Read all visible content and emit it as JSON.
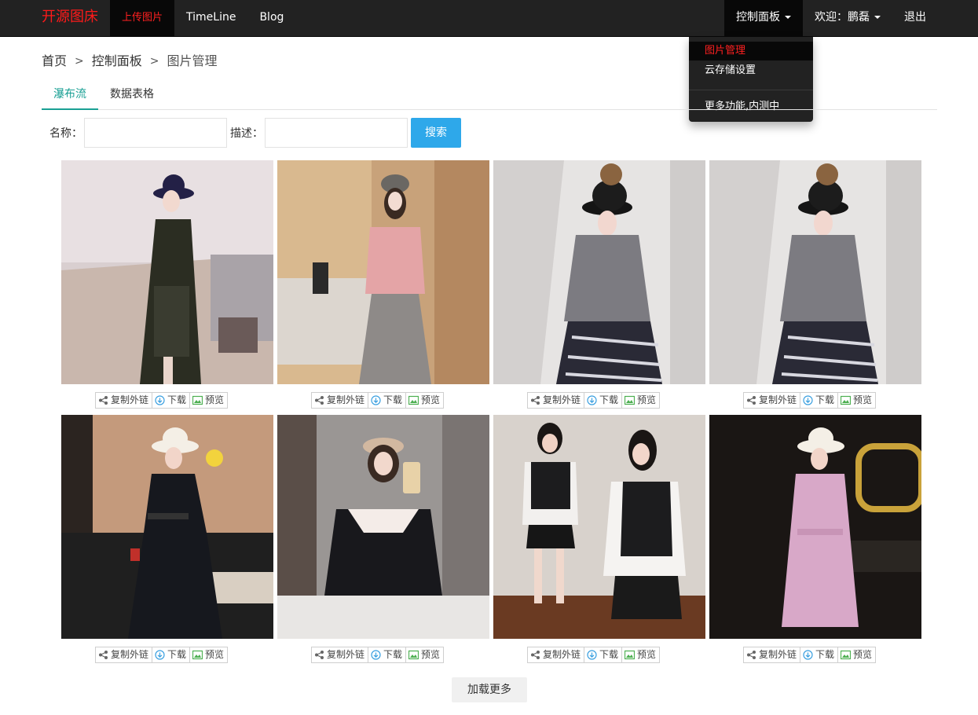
{
  "navbar": {
    "brand": "开源图床",
    "left_items": [
      "上传图片",
      "TimeLine",
      "Blog"
    ],
    "right_items": {
      "control_panel": "控制面板",
      "welcome": "欢迎：鹏磊",
      "logout": "退出"
    }
  },
  "dropdown": {
    "items": [
      "图片管理",
      "云存储设置"
    ],
    "extra": "更多功能,内测中"
  },
  "breadcrumb": {
    "home": "首页",
    "panel": "控制面板",
    "current": "图片管理",
    "separator": ">"
  },
  "tabs": [
    "瀑布流",
    "数据表格"
  ],
  "search": {
    "name_label": "名称：",
    "desc_label": "描述：",
    "name_value": "",
    "desc_value": "",
    "button": "搜索"
  },
  "actions": {
    "copy": "复制外链",
    "download": "下载",
    "preview": "预览"
  },
  "photos": [
    {
      "subject": "woman in dark green coat and black hat"
    },
    {
      "subject": "woman in pink jacket and grey skirt"
    },
    {
      "subject": "woman in grey turtleneck and black pompom hat"
    },
    {
      "subject": "woman in grey turtleneck and black pompom hat"
    },
    {
      "subject": "woman in black dress and white hat"
    },
    {
      "subject": "woman in black sweater taking selfie"
    },
    {
      "subject": "two women in black vests and star skirts"
    },
    {
      "subject": "woman in pink coat and white hat"
    }
  ],
  "load_more": "加载更多",
  "colors": {
    "navbar": "#222222",
    "brand": "#ff1a1a",
    "tab_active": "#1aa094",
    "search_button": "#2ea8ea"
  }
}
